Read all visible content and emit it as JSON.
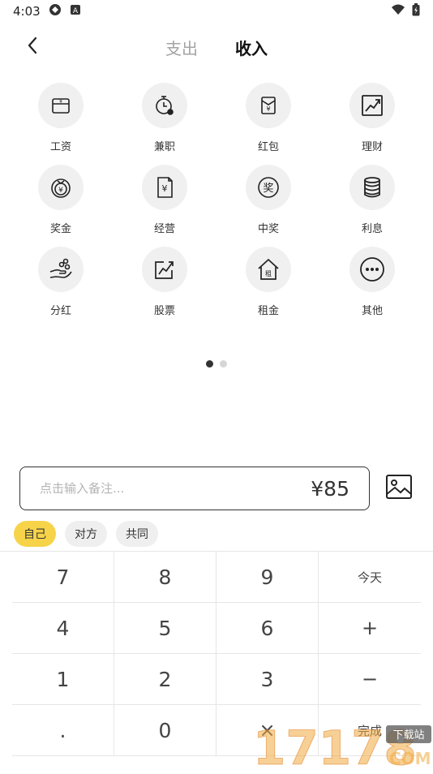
{
  "status_bar": {
    "time": "4:03",
    "icons": [
      "sync-icon",
      "a-badge-icon",
      "wifi-icon",
      "battery-icon"
    ]
  },
  "header": {
    "back_icon": "chevron-left-icon",
    "tabs": [
      {
        "label": "支出",
        "active": false
      },
      {
        "label": "收入",
        "active": true
      }
    ]
  },
  "categories": [
    {
      "label": "工资",
      "icon": "wallet-icon"
    },
    {
      "label": "兼职",
      "icon": "stopwatch-icon"
    },
    {
      "label": "红包",
      "icon": "red-envelope-icon"
    },
    {
      "label": "理财",
      "icon": "trend-up-icon"
    },
    {
      "label": "奖金",
      "icon": "money-bag-icon"
    },
    {
      "label": "经营",
      "icon": "receipt-icon"
    },
    {
      "label": "中奖",
      "icon": "prize-icon"
    },
    {
      "label": "利息",
      "icon": "coin-stack-icon"
    },
    {
      "label": "分红",
      "icon": "hand-coins-icon"
    },
    {
      "label": "股票",
      "icon": "stock-chart-icon"
    },
    {
      "label": "租金",
      "icon": "house-rent-icon"
    },
    {
      "label": "其他",
      "icon": "more-dots-icon"
    }
  ],
  "pager": {
    "count": 2,
    "active_index": 0
  },
  "note": {
    "placeholder": "点击输入备注...",
    "value": "",
    "amount": "¥85"
  },
  "image_button": {
    "icon": "image-icon"
  },
  "payers": [
    {
      "label": "自己",
      "selected": true
    },
    {
      "label": "对方",
      "selected": false
    },
    {
      "label": "共同",
      "selected": false
    }
  ],
  "keypad": {
    "keys": [
      "7",
      "8",
      "9",
      "今天",
      "4",
      "5",
      "6",
      "+",
      "1",
      "2",
      "3",
      "−",
      ".",
      "0",
      "×",
      "完成"
    ]
  },
  "watermark": {
    "text": "17178",
    "subtext": "下载站",
    "suffix": "COM"
  },
  "colors": {
    "accent_yellow": "#f7d34a",
    "chip_gray": "#efefef",
    "circle_gray": "#f0f0f0",
    "text_dark": "#222222",
    "tab_inactive": "#a4a4a4"
  }
}
